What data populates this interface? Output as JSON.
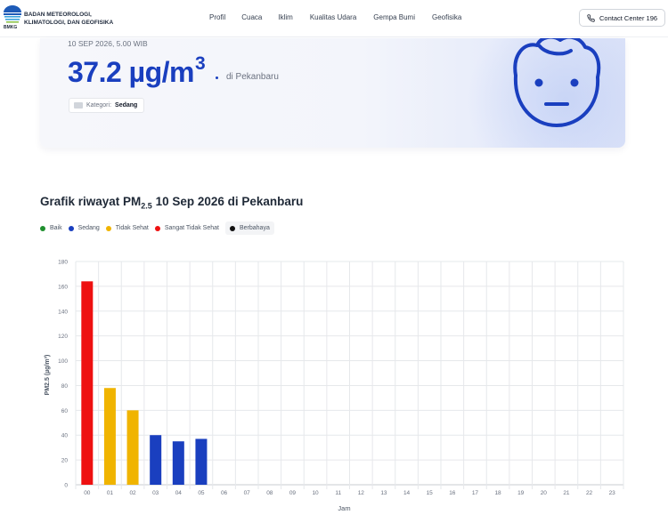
{
  "nav": {
    "brand_line1": "BADAN METEOROLOGI,",
    "brand_line2": "KLIMATOLOGI, DAN GEOFISIKA",
    "logo_text": "BMKG",
    "menu": [
      "Profil",
      "Cuaca",
      "Iklim",
      "Kualitas Udara",
      "Gempa Bumi",
      "Geofisika"
    ],
    "contact": "Contact Center 196"
  },
  "hero": {
    "timestamp": "10 SEP 2026, 5.00 WIB",
    "value": "37.2 µg/m",
    "value_sup": "3",
    "location": "di Pekanbaru",
    "category_label": "Kategori:",
    "category_value": "Sedang",
    "face_icon": "neutral-face-icon",
    "accent_color": "#1a3fbf"
  },
  "chart_section": {
    "title_prefix": "Grafik riwayat PM",
    "title_sub": "2.5",
    "title_suffix": " 10 Sep 2026 di Pekanbaru",
    "legend": [
      {
        "label": "Baik",
        "color": "#1f8f2e"
      },
      {
        "label": "Sedang",
        "color": "#1a3fbf"
      },
      {
        "label": "Tidak Sehat",
        "color": "#f0b400"
      },
      {
        "label": "Sangat Tidak Sehat",
        "color": "#ee1111"
      },
      {
        "label": "Berbahaya",
        "color": "#111111"
      }
    ]
  },
  "chart_data": {
    "type": "bar",
    "xlabel": "Jam",
    "ylabel": "PM2.5 (µg/m³)",
    "ylim": [
      0,
      180
    ],
    "yticks": [
      0,
      20,
      40,
      60,
      80,
      100,
      120,
      140,
      160,
      180
    ],
    "grid": true,
    "categories": [
      "00",
      "01",
      "02",
      "03",
      "04",
      "05",
      "06",
      "07",
      "08",
      "09",
      "10",
      "11",
      "12",
      "13",
      "14",
      "15",
      "16",
      "17",
      "18",
      "19",
      "20",
      "21",
      "22",
      "23"
    ],
    "values": [
      164,
      78,
      60,
      40,
      35,
      37,
      null,
      null,
      null,
      null,
      null,
      null,
      null,
      null,
      null,
      null,
      null,
      null,
      null,
      null,
      null,
      null,
      null,
      null
    ],
    "bar_colors": [
      "#ee1111",
      "#f0b400",
      "#f0b400",
      "#1a3fbf",
      "#1a3fbf",
      "#1a3fbf"
    ]
  }
}
